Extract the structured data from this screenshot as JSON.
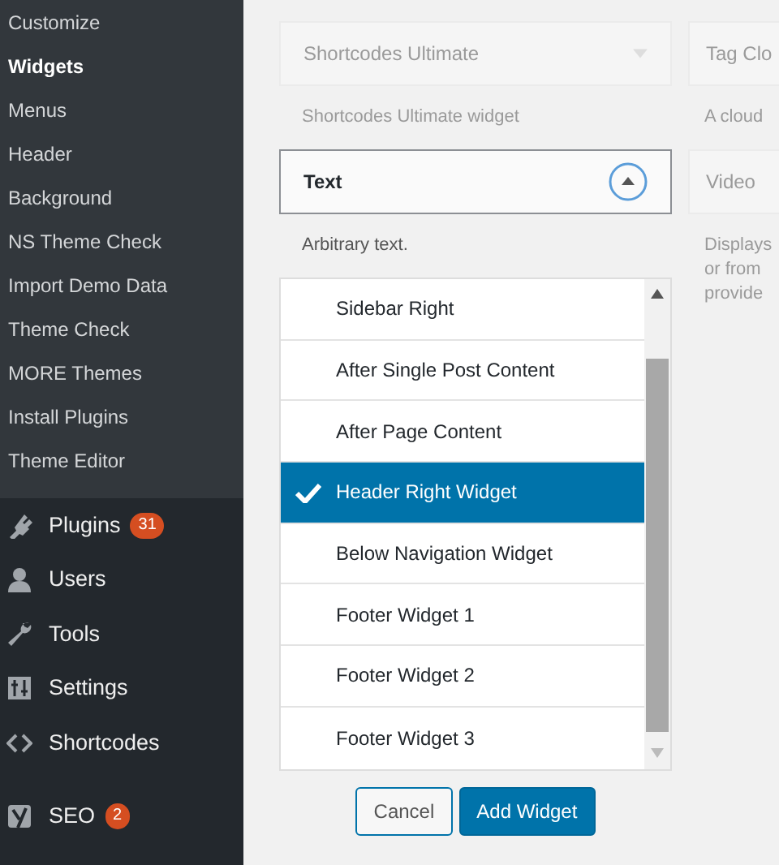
{
  "sidebar": {
    "submenu": [
      {
        "label": "Customize",
        "selected": false
      },
      {
        "label": "Widgets",
        "selected": true
      },
      {
        "label": "Menus",
        "selected": false
      },
      {
        "label": "Header",
        "selected": false
      },
      {
        "label": "Background",
        "selected": false
      },
      {
        "label": "NS Theme Check",
        "selected": false
      },
      {
        "label": "Import Demo Data",
        "selected": false
      },
      {
        "label": "Theme Check",
        "selected": false
      },
      {
        "label": "MORE Themes",
        "selected": false
      },
      {
        "label": "Install Plugins",
        "selected": false
      },
      {
        "label": "Theme Editor",
        "selected": false
      }
    ],
    "menu": [
      {
        "label": "Plugins",
        "kind": "plugins",
        "badge": "31"
      },
      {
        "label": "Users",
        "kind": "users"
      },
      {
        "label": "Tools",
        "kind": "tools"
      },
      {
        "label": "Settings",
        "kind": "settings"
      },
      {
        "label": "Shortcodes",
        "kind": "code"
      },
      {
        "label": "SEO",
        "kind": "seo",
        "badge": "2"
      }
    ]
  },
  "widgets": {
    "column_1": [
      {
        "title": "Shortcodes Ultimate",
        "description": [
          "Shortcodes Ultimate widget"
        ],
        "dimmed": true,
        "expanded": false
      },
      {
        "title": "Text",
        "description": [
          "Arbitrary text."
        ],
        "dimmed": false,
        "expanded": true
      }
    ],
    "column_2": [
      {
        "title": "Tag Clo",
        "description": [
          "A cloud"
        ],
        "dimmed": true
      },
      {
        "title": "Video",
        "description": [
          "Displays",
          "or from",
          "provide"
        ],
        "dimmed": true
      }
    ]
  },
  "area_chooser": {
    "items": [
      {
        "label": "Sidebar Right",
        "selected": false
      },
      {
        "label": "After Single Post Content",
        "selected": false
      },
      {
        "label": "After Page Content",
        "selected": false
      },
      {
        "label": "Header Right Widget",
        "selected": true
      },
      {
        "label": "Below Navigation Widget",
        "selected": false
      },
      {
        "label": "Footer Widget 1",
        "selected": false
      },
      {
        "label": "Footer Widget 2",
        "selected": false
      },
      {
        "label": "Footer Widget 3",
        "selected": false
      }
    ],
    "buttons": [
      {
        "label": "Cancel",
        "kind": "secondary"
      },
      {
        "label": "Add Widget",
        "kind": "primary"
      }
    ]
  }
}
